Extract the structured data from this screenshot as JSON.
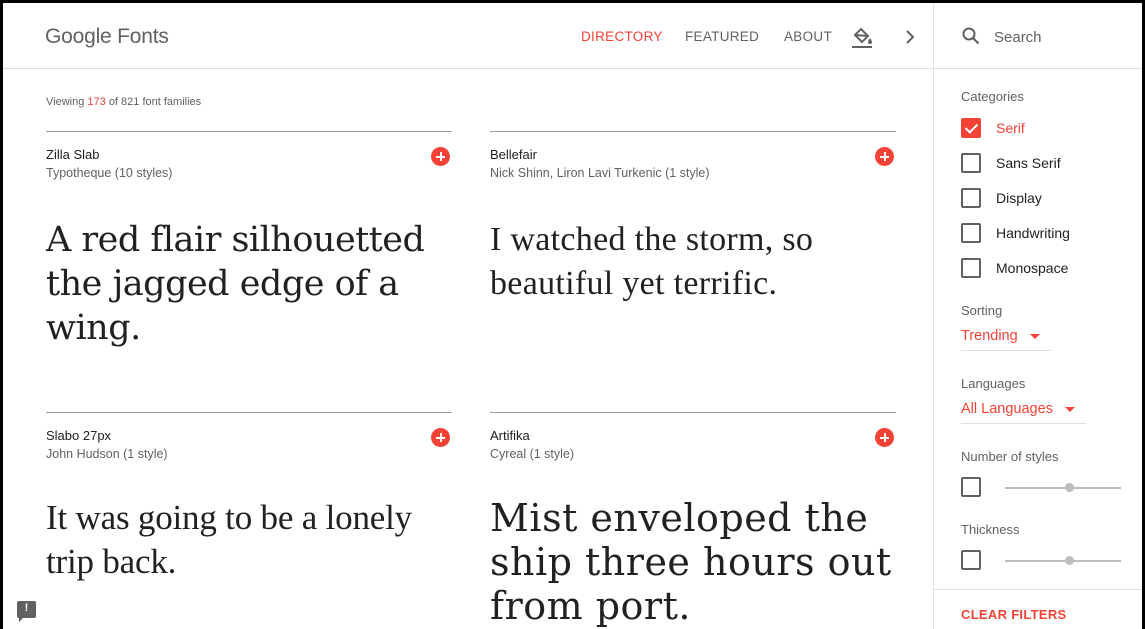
{
  "header": {
    "logo": "Google Fonts",
    "nav": [
      {
        "label": "DIRECTORY",
        "active": true
      },
      {
        "label": "FEATURED",
        "active": false
      },
      {
        "label": "ABOUT",
        "active": false
      }
    ],
    "icons": [
      "paint-bucket-icon",
      "chevron-right-icon"
    ]
  },
  "search": {
    "placeholder": "Search",
    "value": ""
  },
  "viewing": {
    "prefix": "Viewing",
    "shown": "173",
    "suffix": "of 821 font families"
  },
  "cards": [
    {
      "name": "Zilla Slab",
      "meta": "Typotheque (10 styles)",
      "sample": "A red flair silhouetted the jagged edge of a wing."
    },
    {
      "name": "Bellefair",
      "meta": "Nick Shinn, Liron Lavi Turkenic (1 style)",
      "sample": "I watched the storm, so beautiful yet terrific."
    },
    {
      "name": "Slabo 27px",
      "meta": "John Hudson (1 style)",
      "sample": "It was going to be a lonely trip back."
    },
    {
      "name": "Artifika",
      "meta": "Cyreal (1 style)",
      "sample": "Mist enveloped the ship three hours out from port."
    }
  ],
  "sidebar": {
    "categories_label": "Categories",
    "categories": [
      {
        "label": "Serif",
        "checked": true
      },
      {
        "label": "Sans Serif",
        "checked": false
      },
      {
        "label": "Display",
        "checked": false
      },
      {
        "label": "Handwriting",
        "checked": false
      },
      {
        "label": "Monospace",
        "checked": false
      }
    ],
    "sorting_label": "Sorting",
    "sorting_value": "Trending",
    "languages_label": "Languages",
    "languages_value": "All Languages",
    "styles_label": "Number of styles",
    "styles_slider": 0.55,
    "thickness_label": "Thickness",
    "thickness_slider": 0.55,
    "clear_label": "CLEAR FILTERS"
  },
  "colors": {
    "accent": "#f44336",
    "text": "#212121",
    "muted": "#616161"
  }
}
